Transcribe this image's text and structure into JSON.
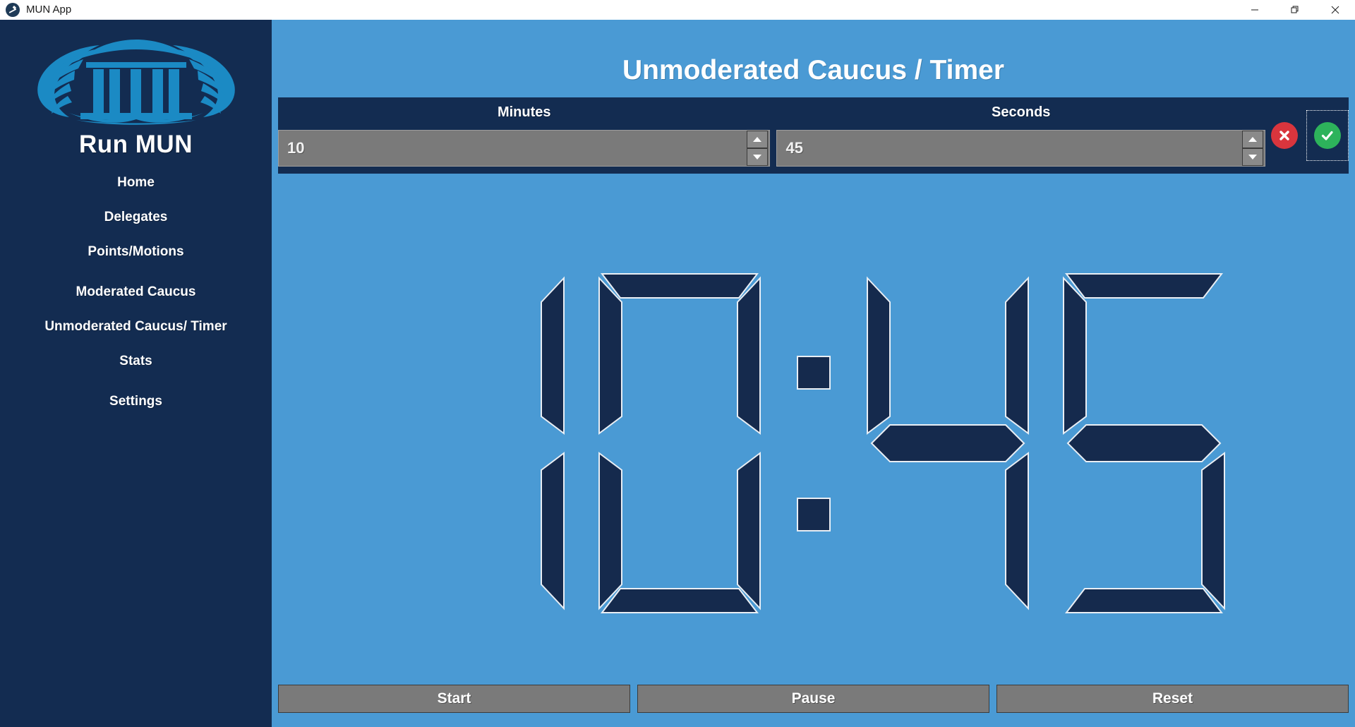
{
  "window": {
    "title": "MUN App",
    "icon": "gavel-icon",
    "controls": {
      "minimize": "minimize-icon",
      "maximize": "restore-icon",
      "close": "close-icon"
    }
  },
  "sidebar": {
    "logo_alt": "un-emblem-logo",
    "brand": "Run MUN",
    "items": [
      {
        "label": "Home"
      },
      {
        "label": "Delegates"
      },
      {
        "label": "Points/Motions"
      },
      {
        "label": "Moderated Caucus"
      },
      {
        "label": "Unmoderated Caucus/ Timer"
      },
      {
        "label": "Stats"
      },
      {
        "label": "Settings"
      }
    ]
  },
  "main": {
    "page_title": "Unmoderated Caucus / Timer",
    "time_entry": {
      "minutes": {
        "label": "Minutes",
        "value": "10",
        "placeholder": "Minutes"
      },
      "seconds": {
        "label": "Seconds",
        "value": "45",
        "placeholder": "Seconds"
      },
      "cancel": "cancel-icon",
      "confirm": "confirm-icon"
    },
    "clock": {
      "minutes_display": "10",
      "seconds_display": "45",
      "separator": ":"
    },
    "controls": [
      {
        "label": "Start"
      },
      {
        "label": "Pause"
      },
      {
        "label": "Reset"
      }
    ]
  },
  "colors": {
    "sidebar_bg": "#132c51",
    "content_bg": "#4a9ad4",
    "logo_blue": "#1b8ac4",
    "segment_fill": "#152a4d",
    "segment_stroke": "#e9eef4",
    "button_gray": "#7a7a7a",
    "cancel_red": "#d9353d",
    "confirm_green": "#2db35b"
  }
}
